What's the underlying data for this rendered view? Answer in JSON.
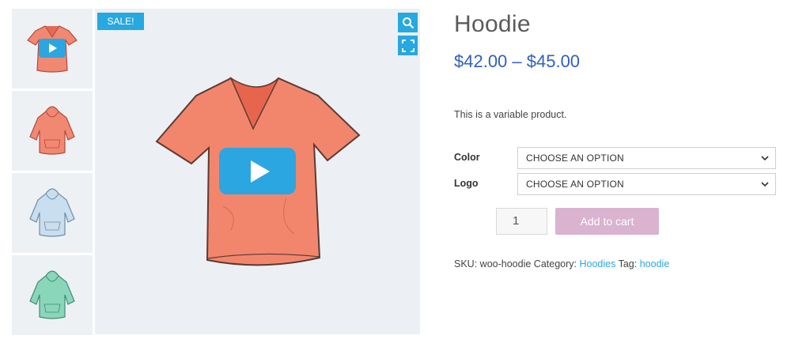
{
  "gallery": {
    "sale_badge": "SALE!",
    "thumbnails": [
      {
        "name": "tshirt-video-thumbnail",
        "color": "#f08872",
        "kind": "tshirt"
      },
      {
        "name": "hoodie-red-thumbnail",
        "color": "#f08872",
        "kind": "hoodie"
      },
      {
        "name": "hoodie-blue-thumbnail",
        "color": "#b9d6ea",
        "kind": "hoodie"
      },
      {
        "name": "hoodie-green-thumbnail",
        "color": "#7fd0b4",
        "kind": "hoodie"
      }
    ],
    "icons": {
      "zoom": "search-icon",
      "fullscreen": "fullscreen-icon",
      "play": "play-icon"
    }
  },
  "product": {
    "title": "Hoodie",
    "price": "$42.00 – $45.00",
    "description": "This is a variable product.",
    "variations": [
      {
        "label": "Color",
        "selected": "CHOOSE AN OPTION"
      },
      {
        "label": "Logo",
        "selected": "CHOOSE AN OPTION"
      }
    ],
    "quantity": "1",
    "add_to_cart": "Add to cart",
    "meta": {
      "sku_label": "SKU:",
      "sku": "woo-hoodie",
      "category_label": "Category:",
      "category": "Hoodies",
      "tag_label": "Tag:",
      "tag": "hoodie"
    }
  },
  "colors": {
    "accent": "#26a8e0",
    "price": "#2f60bd",
    "add_to_cart_bg": "#d9b3cf",
    "link": "#2ba6e0"
  }
}
